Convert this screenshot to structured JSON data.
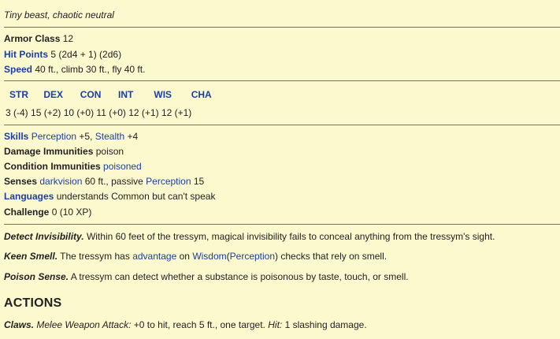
{
  "subtitle": "Tiny beast, chaotic neutral",
  "armor_class": {
    "label": "Armor Class",
    "value": "12"
  },
  "hit_points": {
    "label": "Hit Points",
    "value": "5 (2d4 + 1) (2d6)"
  },
  "speed": {
    "label": "Speed",
    "value": "40 ft., climb 30 ft., fly 40 ft."
  },
  "abilities": {
    "headers": [
      "STR",
      "DEX",
      "CON",
      "INT",
      "WIS",
      "CHA"
    ],
    "values": [
      "3 (-4)",
      "15 (+2)",
      "10 (+0)",
      "11 (+0)",
      "12 (+1)",
      "12 (+1)"
    ]
  },
  "skills": {
    "label": "Skills",
    "perception": "Perception",
    "perception_val": "+5,",
    "stealth": "Stealth",
    "stealth_val": "+4"
  },
  "damage_immunities": {
    "label": "Damage Immunities",
    "value": "poison"
  },
  "condition_immunities": {
    "label": "Condition Immunities",
    "value": "poisoned"
  },
  "senses": {
    "label": "Senses",
    "darkvision": "darkvision",
    "mid": "60 ft., passive",
    "perception": "Perception",
    "value": "15"
  },
  "languages": {
    "label": "Languages",
    "value": "understands Common but can't speak"
  },
  "challenge": {
    "label": "Challenge",
    "value": "0 (10 XP)"
  },
  "traits": {
    "detect_invisibility": {
      "name": "Detect Invisibility.",
      "text": "Within 60 feet of the tressym, magical invisibility fails to conceal anything from the tressym's sight."
    },
    "keen_smell": {
      "name": "Keen Smell.",
      "t1": "The tressym has",
      "advantage": "advantage",
      "t2": "on",
      "wisdom": "Wisdom",
      "paren_open": "(",
      "perception": "Perception",
      "t3": ") checks that rely on smell."
    },
    "poison_sense": {
      "name": "Poison Sense.",
      "text": "A tressym can detect whether a substance is poisonous by taste, touch, or smell."
    }
  },
  "actions": {
    "heading": "ACTIONS",
    "claws": {
      "name": "Claws.",
      "attack_type": "Melee Weapon Attack:",
      "text": "+0 to hit, reach 5 ft., one target.",
      "hit_label": "Hit:",
      "hit_text": "1 slashing damage."
    }
  }
}
